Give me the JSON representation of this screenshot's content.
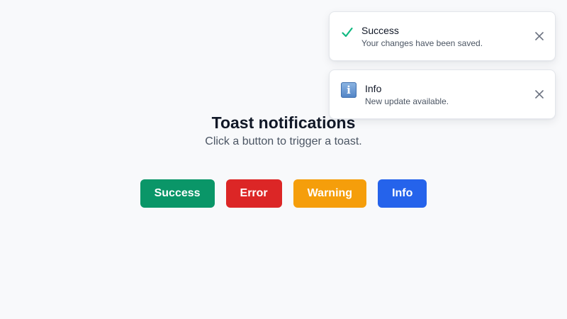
{
  "toasts": [
    {
      "type": "success",
      "icon": "check-icon",
      "title": "Success",
      "message": "Your changes have been saved.",
      "close_icon": "close-icon",
      "accent": "#10b981"
    },
    {
      "type": "info",
      "icon": "info-icon",
      "title": "Info",
      "message": "New update available.",
      "close_icon": "close-icon",
      "accent": "#4f82c5"
    }
  ],
  "page": {
    "title": "Toast notifications",
    "subtitle": "Click a button to trigger a toast."
  },
  "buttons": [
    {
      "label": "Success",
      "color": "#0a9668"
    },
    {
      "label": "Error",
      "color": "#dc2626"
    },
    {
      "label": "Warning",
      "color": "#f59e0b"
    },
    {
      "label": "Info",
      "color": "#2563eb"
    }
  ],
  "colors": {
    "background": "#f8f9fb",
    "text_primary": "#111827",
    "text_secondary": "#4b5563"
  }
}
